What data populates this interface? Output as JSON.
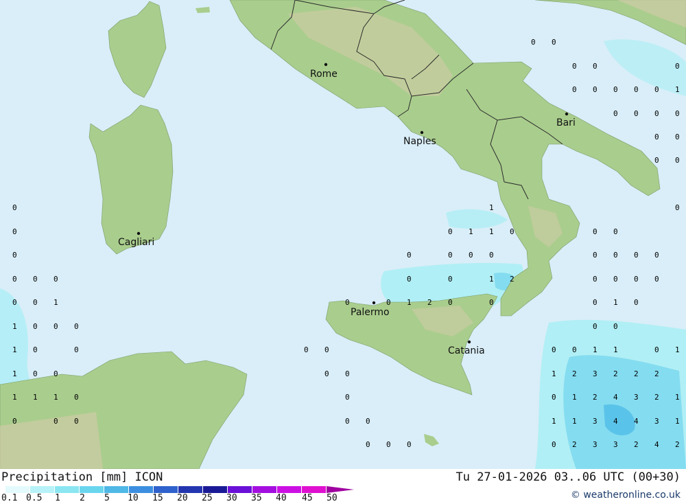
{
  "title": "Precipitation [mm] ICON",
  "datetime": "Tu 27-01-2026 03..06 UTC (00+30)",
  "credit": "© weatheronline.co.uk",
  "colors": {
    "sea": "#d9eef8",
    "land": "#a9cd8d",
    "land_highland": "#d6ccaa",
    "border": "#2b2b2b",
    "precip_light": "#a8eef5",
    "precip_medium": "#7fd9f0",
    "precip_heavy": "#55c0e8"
  },
  "legend": {
    "labels": [
      "0.1",
      "0.5",
      "1",
      "2",
      "5",
      "10",
      "15",
      "20",
      "25",
      "30",
      "35",
      "40",
      "45",
      "50"
    ],
    "colors": [
      "#e4fafd",
      "#b6f2f7",
      "#8ce6f1",
      "#6ad6ee",
      "#4fb8e6",
      "#3c8fe0",
      "#2f62cc",
      "#2435b0",
      "#1b1a96",
      "#6a10d8",
      "#a40fe0",
      "#cc10e4",
      "#e010d0",
      "#c800b8"
    ]
  },
  "cities": [
    {
      "name": "Rome"
    },
    {
      "name": "Bari"
    },
    {
      "name": "Naples"
    },
    {
      "name": "Cagliari"
    },
    {
      "name": "Palermo"
    },
    {
      "name": "Catania"
    }
  ],
  "values": {
    "r1": [
      "0",
      "0"
    ],
    "r2": [
      "0",
      "0",
      "0"
    ],
    "r3": [
      "0",
      "0",
      "0",
      "0",
      "0",
      "1"
    ],
    "r4": [
      "0",
      "0",
      "0",
      "0"
    ],
    "r5": [
      "0",
      "0"
    ],
    "r6": [
      "0",
      "0"
    ],
    "r7": [
      "0",
      "1",
      "0"
    ],
    "r8": [
      "0",
      "0",
      "1",
      "1",
      "0",
      "0",
      "0"
    ],
    "r9": [
      "0",
      "0",
      "0",
      "0",
      "0",
      "0",
      "0",
      "0",
      "0"
    ],
    "r10": [
      "0",
      "0",
      "0",
      "0",
      "0",
      "1",
      "2",
      "0",
      "0",
      "0",
      "0"
    ],
    "r11": [
      "0",
      "0",
      "1",
      "0",
      "0",
      "1",
      "2",
      "0",
      "0",
      "0",
      "1",
      "0"
    ],
    "r12": [
      "1",
      "0",
      "0",
      "0",
      "0",
      "0"
    ],
    "r13": [
      "1",
      "0",
      "0",
      "0",
      "0",
      "0",
      "0",
      "1",
      "1",
      "0",
      "1"
    ],
    "r14": [
      "1",
      "0",
      "0",
      "0",
      "0",
      "1",
      "2",
      "3",
      "2",
      "2",
      "2"
    ],
    "r15": [
      "1",
      "1",
      "1",
      "0",
      "0",
      "0",
      "1",
      "2",
      "4",
      "3",
      "2",
      "1"
    ],
    "r16": [
      "0",
      "0",
      "0",
      "0",
      "0",
      "1",
      "1",
      "3",
      "4",
      "4",
      "3",
      "1"
    ],
    "r17": [
      "0",
      "0",
      "0",
      "0",
      "2",
      "3",
      "3",
      "2",
      "4",
      "2"
    ]
  }
}
